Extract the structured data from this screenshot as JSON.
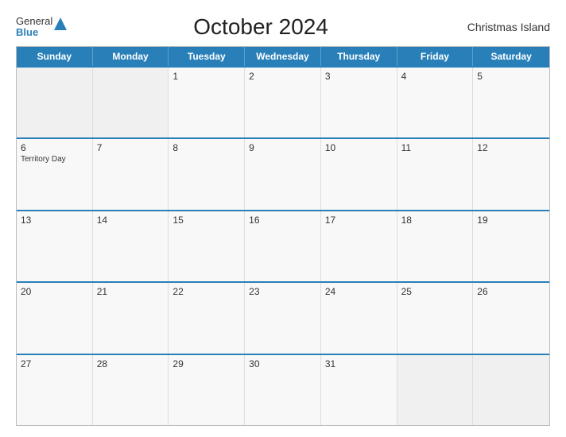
{
  "header": {
    "logo_general": "General",
    "logo_blue": "Blue",
    "title": "October 2024",
    "region": "Christmas Island"
  },
  "calendar": {
    "days_of_week": [
      "Sunday",
      "Monday",
      "Tuesday",
      "Wednesday",
      "Thursday",
      "Friday",
      "Saturday"
    ],
    "weeks": [
      [
        {
          "day": "",
          "empty": true
        },
        {
          "day": "",
          "empty": true
        },
        {
          "day": "1",
          "empty": false,
          "event": ""
        },
        {
          "day": "2",
          "empty": false,
          "event": ""
        },
        {
          "day": "3",
          "empty": false,
          "event": ""
        },
        {
          "day": "4",
          "empty": false,
          "event": ""
        },
        {
          "day": "5",
          "empty": false,
          "event": ""
        }
      ],
      [
        {
          "day": "6",
          "empty": false,
          "event": "Territory Day"
        },
        {
          "day": "7",
          "empty": false,
          "event": ""
        },
        {
          "day": "8",
          "empty": false,
          "event": ""
        },
        {
          "day": "9",
          "empty": false,
          "event": ""
        },
        {
          "day": "10",
          "empty": false,
          "event": ""
        },
        {
          "day": "11",
          "empty": false,
          "event": ""
        },
        {
          "day": "12",
          "empty": false,
          "event": ""
        }
      ],
      [
        {
          "day": "13",
          "empty": false,
          "event": ""
        },
        {
          "day": "14",
          "empty": false,
          "event": ""
        },
        {
          "day": "15",
          "empty": false,
          "event": ""
        },
        {
          "day": "16",
          "empty": false,
          "event": ""
        },
        {
          "day": "17",
          "empty": false,
          "event": ""
        },
        {
          "day": "18",
          "empty": false,
          "event": ""
        },
        {
          "day": "19",
          "empty": false,
          "event": ""
        }
      ],
      [
        {
          "day": "20",
          "empty": false,
          "event": ""
        },
        {
          "day": "21",
          "empty": false,
          "event": ""
        },
        {
          "day": "22",
          "empty": false,
          "event": ""
        },
        {
          "day": "23",
          "empty": false,
          "event": ""
        },
        {
          "day": "24",
          "empty": false,
          "event": ""
        },
        {
          "day": "25",
          "empty": false,
          "event": ""
        },
        {
          "day": "26",
          "empty": false,
          "event": ""
        }
      ],
      [
        {
          "day": "27",
          "empty": false,
          "event": ""
        },
        {
          "day": "28",
          "empty": false,
          "event": ""
        },
        {
          "day": "29",
          "empty": false,
          "event": ""
        },
        {
          "day": "30",
          "empty": false,
          "event": ""
        },
        {
          "day": "31",
          "empty": false,
          "event": ""
        },
        {
          "day": "",
          "empty": true
        },
        {
          "day": "",
          "empty": true
        }
      ]
    ]
  }
}
